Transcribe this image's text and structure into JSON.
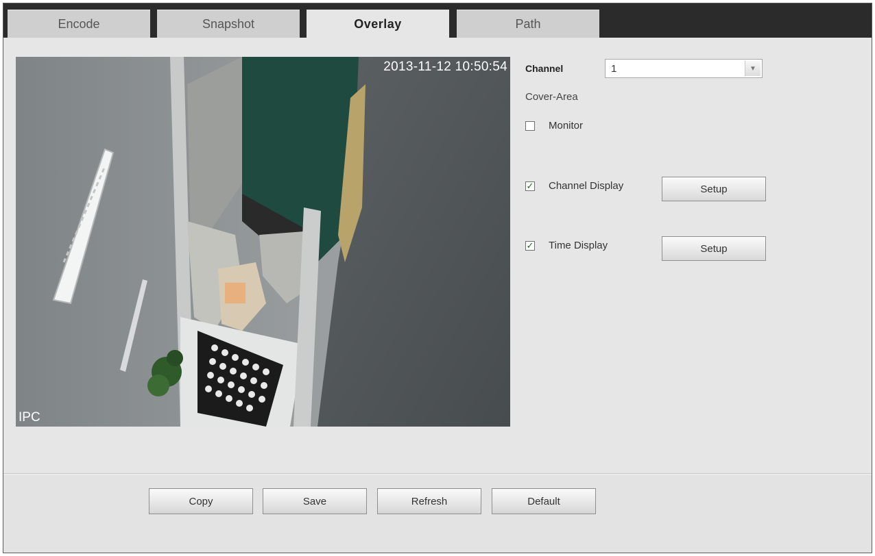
{
  "tabs": [
    {
      "label": "Encode",
      "active": false
    },
    {
      "label": "Snapshot",
      "active": false
    },
    {
      "label": "Overlay",
      "active": true
    },
    {
      "label": "Path",
      "active": false
    }
  ],
  "preview": {
    "timestamp": "2013-11-12 10:50:54",
    "channel_name": "IPC"
  },
  "settings": {
    "channel_label": "Channel",
    "channel_value": "1",
    "cover_area_label": "Cover-Area",
    "monitor": {
      "label": "Monitor",
      "checked": false
    },
    "channel_display": {
      "label": "Channel Display",
      "checked": true,
      "button": "Setup"
    },
    "time_display": {
      "label": "Time Display",
      "checked": true,
      "button": "Setup"
    }
  },
  "footer": {
    "copy": "Copy",
    "save": "Save",
    "refresh": "Refresh",
    "default": "Default"
  },
  "icons": {
    "dropdown": "chevron-down-icon",
    "check": "check-icon"
  },
  "colors": {
    "tab_bar": "#2b2b2b",
    "panel": "#e6e6e6",
    "check": "#1f6b1f"
  }
}
